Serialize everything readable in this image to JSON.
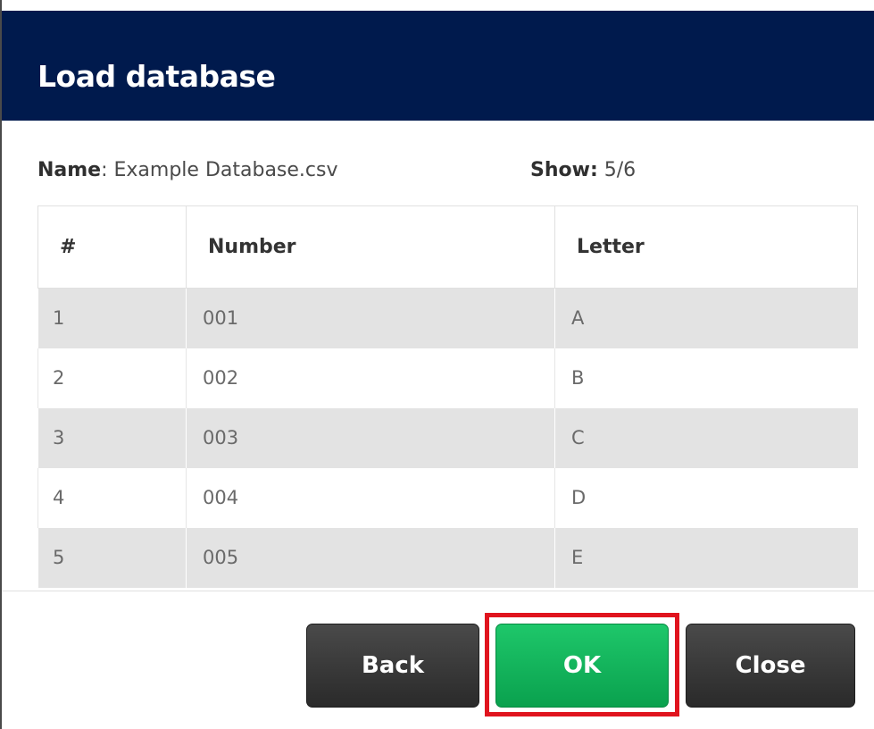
{
  "dialog": {
    "title": "Load database",
    "name_label": "Name",
    "name_value": ": Example Database.csv",
    "show_label": "Show:",
    "show_value": " 5/6"
  },
  "table": {
    "headers": [
      "#",
      "Number",
      "Letter"
    ],
    "rows": [
      [
        "1",
        "001",
        "A"
      ],
      [
        "2",
        "002",
        "B"
      ],
      [
        "3",
        "003",
        "C"
      ],
      [
        "4",
        "004",
        "D"
      ],
      [
        "5",
        "005",
        "E"
      ]
    ]
  },
  "buttons": {
    "back": "Back",
    "ok": "OK",
    "close": "Close"
  },
  "colors": {
    "header_bg": "#001a4d",
    "ok_green": "#0fb35a",
    "highlight_red": "#e0141e",
    "dark_button": "#333333"
  }
}
